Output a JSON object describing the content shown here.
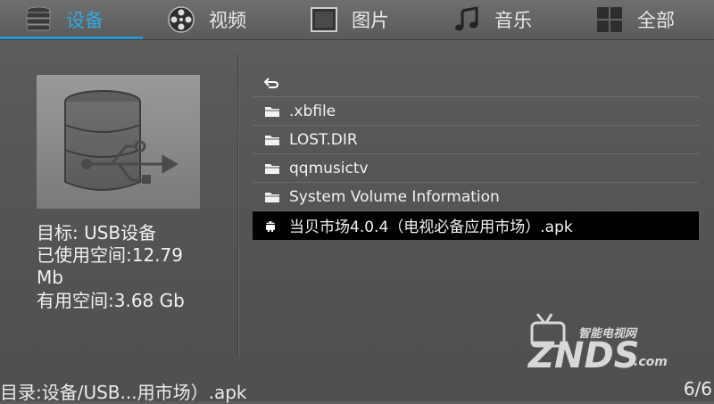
{
  "tabs": [
    {
      "label": "设备",
      "icon": "storage-icon"
    },
    {
      "label": "视频",
      "icon": "film-reel-icon"
    },
    {
      "label": "图片",
      "icon": "picture-frame-icon"
    },
    {
      "label": "音乐",
      "icon": "music-note-icon"
    },
    {
      "label": "全部",
      "icon": "grid-icon"
    }
  ],
  "info": {
    "target": "目标: USB设备",
    "used_line1": "已使用空间:12.79",
    "used_line2": "Mb",
    "free": "有用空间:3.68 Gb"
  },
  "files": [
    {
      "name": "",
      "icon": "back-arrow-icon"
    },
    {
      "name": ".xbfile",
      "icon": "folder-icon"
    },
    {
      "name": "LOST.DIR",
      "icon": "folder-icon"
    },
    {
      "name": "qqmusictv",
      "icon": "folder-icon"
    },
    {
      "name": "System Volume Information",
      "icon": "folder-icon"
    },
    {
      "name": "当贝市场4.0.4（电视必备应用市场）.apk",
      "icon": "android-icon",
      "selected": true
    }
  ],
  "status": {
    "path": "目录:设备/USB...用市场）.apk",
    "count": "6/6"
  },
  "watermark": {
    "brand": "ZNDS",
    "suffix": ".com",
    "tagline": "智能电视网"
  },
  "colors": {
    "accent": "#34a7e0",
    "selected_bg": "#000000"
  }
}
